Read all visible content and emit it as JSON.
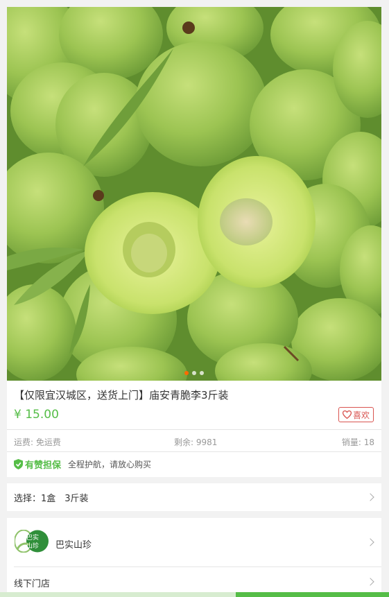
{
  "product": {
    "title": "【仅限宜汉城区，送货上门】庙安青脆李3斤装",
    "price": "¥ 15.00",
    "like_label": "喜欢"
  },
  "stats": {
    "shipping": "运费: 免运费",
    "stock": "剩余: 9981",
    "sales": "销量: 18"
  },
  "guarantee": {
    "title": "有赞担保",
    "desc": "全程护航，请放心购买"
  },
  "option": {
    "label": "选择：1盒　3斤装"
  },
  "shop": {
    "logo_text_top": "巴实",
    "logo_text_bottom": "山珍",
    "name": "巴实山珍",
    "offline_label": "线下门店"
  },
  "carousel": {
    "slides": 3,
    "active_index": 0
  },
  "colors": {
    "accent": "#55bd47",
    "like": "#d9534f",
    "active_dot": "#ff6a00"
  }
}
